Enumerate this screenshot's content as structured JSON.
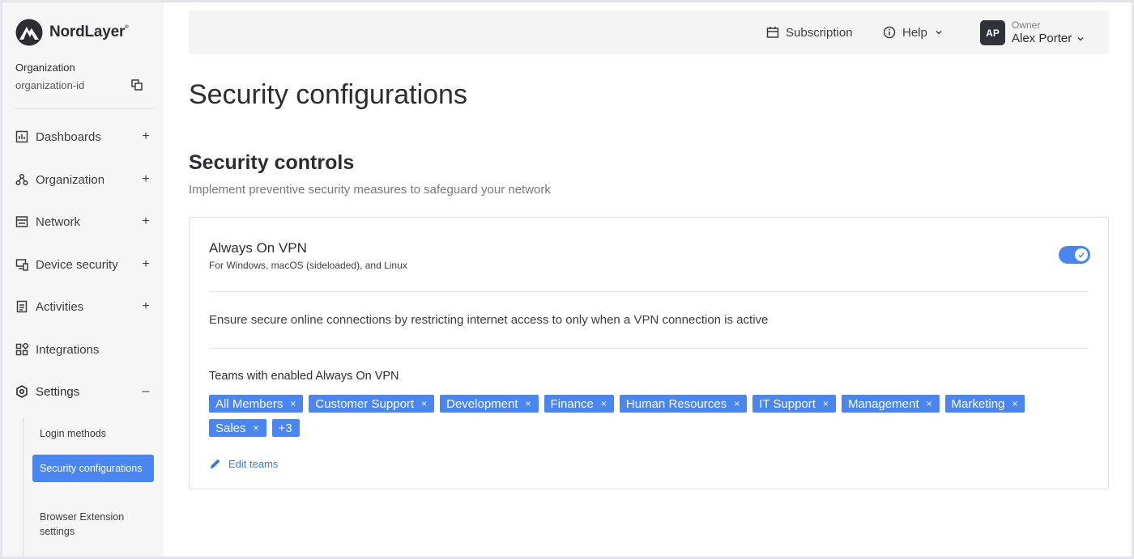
{
  "brand": {
    "name": "NordLayer",
    "mark": "®"
  },
  "sidebar": {
    "org_label": "Organization",
    "org_id": "organization-id",
    "items": [
      {
        "label": "Dashboards",
        "sign": "+"
      },
      {
        "label": "Organization",
        "sign": "+"
      },
      {
        "label": "Network",
        "sign": "+"
      },
      {
        "label": "Device security",
        "sign": "+"
      },
      {
        "label": "Activities",
        "sign": "+"
      },
      {
        "label": "Integrations",
        "sign": ""
      },
      {
        "label": "Settings",
        "sign": "–"
      }
    ],
    "sub_items": [
      {
        "label": "Login methods"
      },
      {
        "label": "Security configurations"
      },
      {
        "label": "Browser Extension settings"
      }
    ]
  },
  "topbar": {
    "subscription": "Subscription",
    "help": "Help",
    "avatar": "AP",
    "role": "Owner",
    "name": "Alex Porter"
  },
  "main": {
    "title": "Security configurations",
    "section_title": "Security controls",
    "section_desc": "Implement preventive security measures to safeguard your network",
    "card": {
      "title": "Always On VPN",
      "subtitle": "For Windows, macOS (sideloaded), and Linux",
      "toggle_on": true,
      "description": "Ensure secure online connections by restricting internet access to only when a VPN connection is active",
      "teams_label": "Teams with enabled Always On VPN",
      "teams": [
        "All Members",
        "Customer Support",
        "Development",
        "Finance",
        "Human Resources",
        "IT Support",
        "Management",
        "Marketing",
        "Sales"
      ],
      "more": "+3",
      "remove_glyph": "×",
      "edit_label": "Edit teams"
    }
  },
  "colors": {
    "accent": "#4a86f0",
    "sidebar_bg": "#f6f6f7",
    "avatar_bg": "#2f3238"
  }
}
